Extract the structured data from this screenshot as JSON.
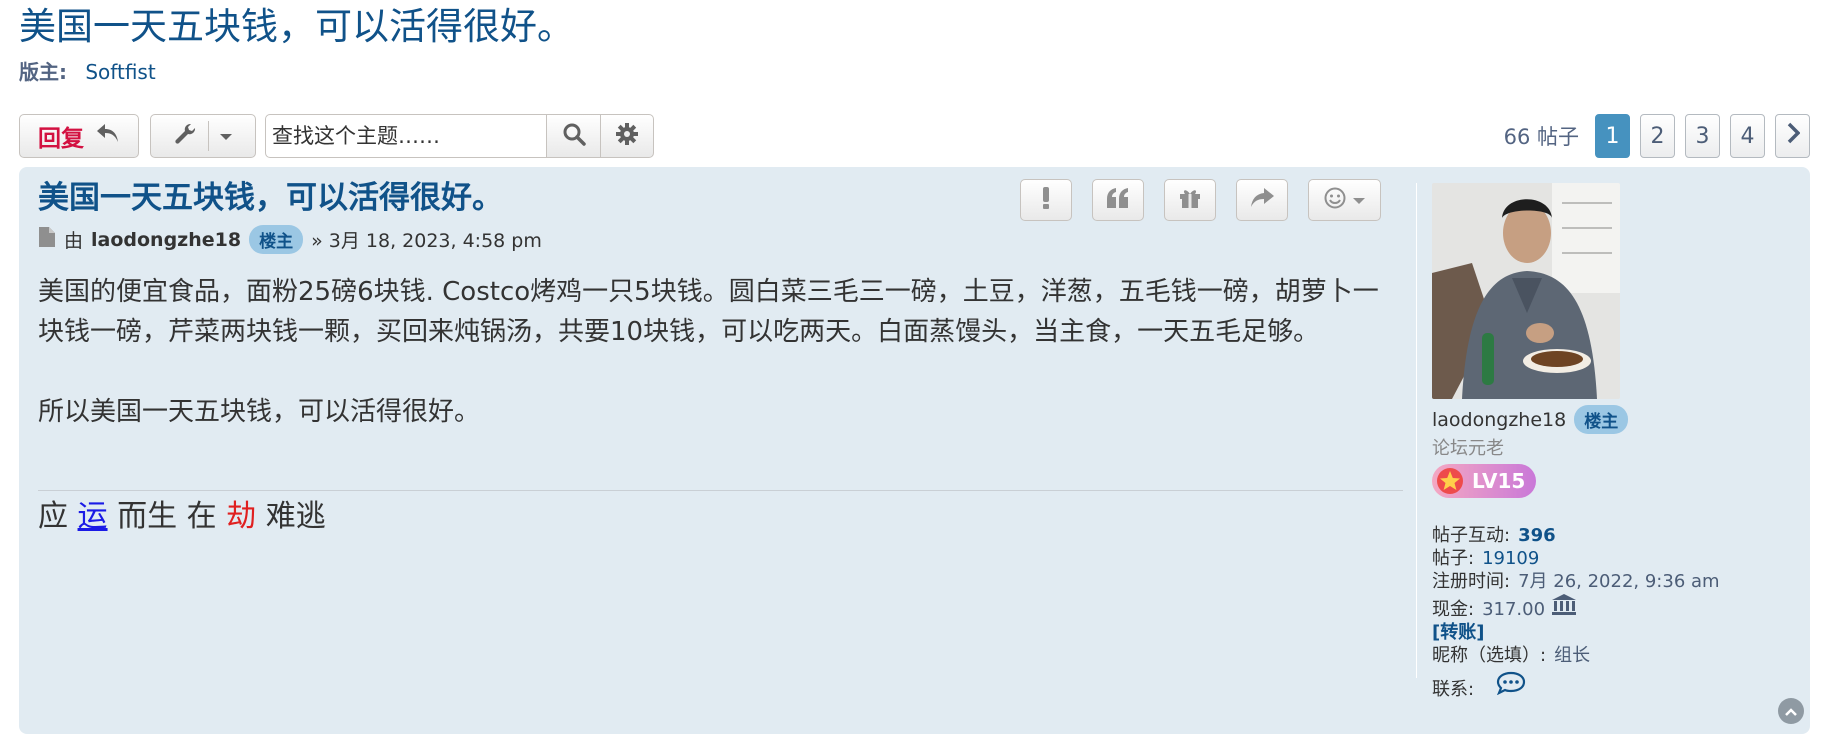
{
  "page": {
    "title": "美国一天五块钱，可以活得很好。",
    "moderators_label": "版主:",
    "moderator_name": "Softfist"
  },
  "action_bar": {
    "reply_label": "回复",
    "search_placeholder": "查找这个主题……",
    "post_count": "66 帖子",
    "pages": [
      "1",
      "2",
      "3",
      "4"
    ],
    "current_page": "1"
  },
  "post": {
    "subject": "美国一天五块钱，可以活得很好。",
    "by_label": "由",
    "author": "laodongzhe18",
    "author_badge": "楼主",
    "datetime": "» 3月 18, 2023, 4:58 pm",
    "content_p1": "美国的便宜食品，面粉25磅6块钱. Costco烤鸡一只5块钱。圆白菜三毛三一磅，土豆，洋葱，五毛钱一磅，胡萝卜一块钱一磅，芹菜两块钱一颗，买回来炖锅汤，共要10块钱，可以吃两天。白面蒸馒头，当主食，一天五毛足够。",
    "content_p2": "所以美国一天五块钱，可以活得很好。",
    "signature": {
      "part1": "应",
      "part2": "运",
      "part3": "而生 在",
      "part4": "劫",
      "part5": "难逃"
    }
  },
  "profile": {
    "username": "laodongzhe18",
    "badge": "楼主",
    "rank": "论坛元老",
    "level": "LV15",
    "interactions_label": "帖子互动:",
    "interactions_value": "396",
    "posts_label": "帖子:",
    "posts_value": "19109",
    "joined_label": "注册时间:",
    "joined_value": "7月 26, 2022, 9:36 am",
    "cash_label": "现金:",
    "cash_value": "317.00",
    "transfer_label": "[转账]",
    "nickname_label": "昵称（选填）:",
    "nickname_value": "组长",
    "contact_label": "联系:"
  },
  "colors": {
    "link": "#105289",
    "post_bg": "#e1ebf2",
    "reply": "#d31141",
    "active_page": "#4692bf"
  },
  "icons": [
    "reply-icon",
    "wrench-icon",
    "caret-down-icon",
    "search-icon",
    "gear-icon",
    "chevron-right-icon",
    "post-icon",
    "report-icon",
    "quote-icon",
    "gift-icon",
    "share-icon",
    "smile-icon",
    "bank-icon",
    "chat-icon",
    "back-to-top-icon"
  ]
}
